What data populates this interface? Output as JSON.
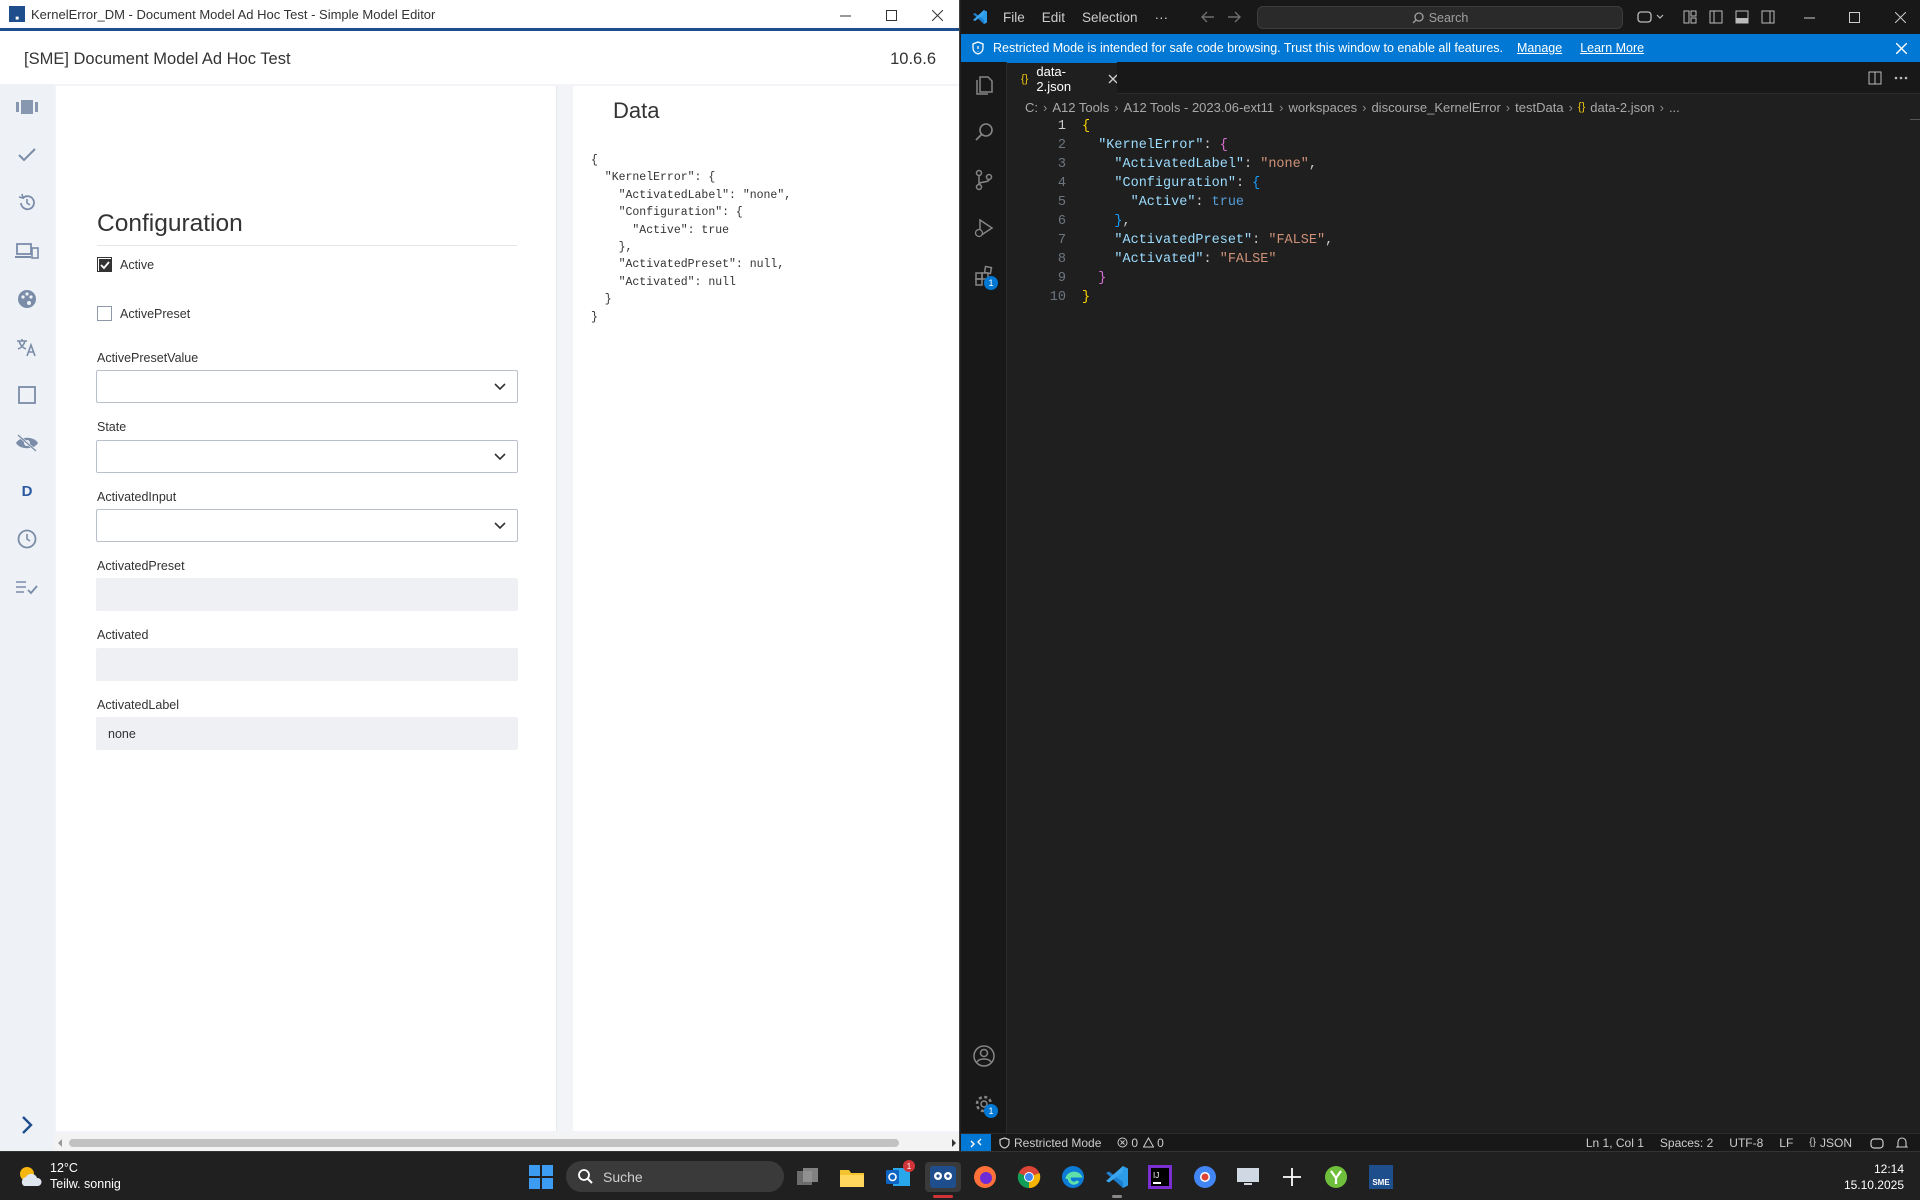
{
  "sme": {
    "window_title": "KernelError_DM - Document Model Ad Hoc Test - Simple Model Editor",
    "app_title": "[SME] Document Model Ad Hoc Test",
    "version": "10.6.6",
    "sidebar_letter": "D",
    "form": {
      "section_title": "Configuration",
      "active_label": "Active",
      "active_checked": true,
      "active_preset_label": "ActivePreset",
      "active_preset_checked": false,
      "fields": {
        "active_preset_value": {
          "label": "ActivePresetValue",
          "value": ""
        },
        "state": {
          "label": "State",
          "value": ""
        },
        "activated_input": {
          "label": "ActivatedInput",
          "value": ""
        },
        "activated_preset": {
          "label": "ActivatedPreset",
          "value": ""
        },
        "activated": {
          "label": "Activated",
          "value": ""
        },
        "activated_label": {
          "label": "ActivatedLabel",
          "value": "none"
        }
      }
    },
    "data_panel": {
      "title": "Data",
      "json_text": "{\n  \"KernelError\": {\n    \"ActivatedLabel\": \"none\",\n    \"Configuration\": {\n      \"Active\": true\n    },\n    \"ActivatedPreset\": null,\n    \"Activated\": null\n  }\n}"
    }
  },
  "vscode": {
    "menu": [
      "File",
      "Edit",
      "Selection",
      "···"
    ],
    "search_placeholder": "Search",
    "banner": {
      "text": "Restricted Mode is intended for safe code browsing. Trust this window to enable all features.",
      "manage": "Manage",
      "learn_more": "Learn More"
    },
    "tab": {
      "name": "data-2.json",
      "icon": "{}"
    },
    "breadcrumb": [
      "C:",
      "A12 Tools",
      "A12 Tools - 2023.06-ext11",
      "workspaces",
      "discourse_KernelError",
      "testData",
      "data-2.json",
      "..."
    ],
    "extensions_badge": "1",
    "settings_badge": "1",
    "lines": [
      "1",
      "2",
      "3",
      "4",
      "5",
      "6",
      "7",
      "8",
      "9",
      "10"
    ],
    "code": {
      "key_kernel": "\"KernelError\"",
      "key_activated_label": "\"ActivatedLabel\"",
      "val_none": "\"none\"",
      "key_configuration": "\"Configuration\"",
      "key_active": "\"Active\"",
      "val_true": "true",
      "key_activated_preset": "\"ActivatedPreset\"",
      "val_false1": "\"FALSE\"",
      "key_activated": "\"Activated\"",
      "val_false2": "\"FALSE\""
    },
    "status": {
      "restricted": "Restricted Mode",
      "errors": "0",
      "warnings": "0",
      "position": "Ln 1, Col 1",
      "spaces": "Spaces: 2",
      "encoding": "UTF-8",
      "eol": "LF",
      "language": "JSON"
    }
  },
  "taskbar": {
    "temperature": "12°C",
    "weather": "Teilw. sonnig",
    "search_placeholder": "Suche",
    "time": "12:14",
    "date": "15.10.2025",
    "sme_label": "SME",
    "mail_badge": "1"
  },
  "colors": {
    "vscode_blue": "#0078d4",
    "sme_accent": "#1f4e8c"
  }
}
